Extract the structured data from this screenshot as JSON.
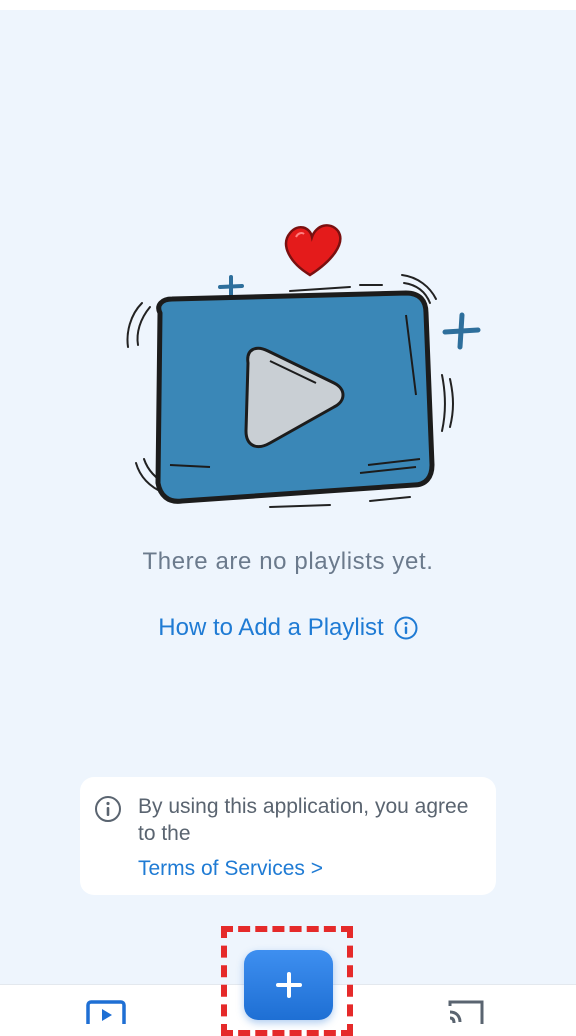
{
  "empty_state": {
    "message": "There are no playlists yet.",
    "how_to_link": "How to Add a Playlist"
  },
  "terms": {
    "notice": "By using this application, you agree to the",
    "link": "Terms of Services >"
  },
  "bottom_nav": {
    "items": [
      {
        "icon": "playlist-icon"
      },
      {
        "icon": "add-icon"
      },
      {
        "icon": "cast-icon"
      }
    ]
  },
  "colors": {
    "background": "#eef5fd",
    "accent": "#1f7bd4",
    "illustration_blue": "#3a87b7",
    "heart_red": "#e41b1b",
    "highlight_red": "#e52a2a"
  }
}
